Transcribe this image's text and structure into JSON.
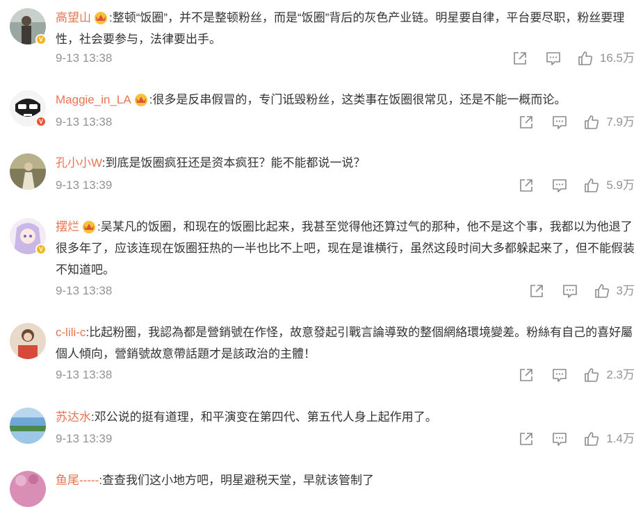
{
  "comments": [
    {
      "user": "高望山",
      "has_crown": true,
      "verified": "gold",
      "text": ":整顿“饭圈”，并不是整顿粉丝，而是“饭圈”背后的灰色产业链。明星要自律，平台要尽职，粉丝要理性，社会要参与，法律要出手。",
      "time": "9-13 13:38",
      "likes": "16.5万"
    },
    {
      "user": "Maggie_in_LA",
      "has_crown": true,
      "verified": "red",
      "text": ":很多是反串假冒的，专门诋毁粉丝，这类事在饭圈很常见，还是不能一概而论。",
      "time": "9-13 13:38",
      "likes": "7.9万"
    },
    {
      "user": "孔小小W",
      "has_crown": false,
      "verified": "",
      "text": ":到底是饭圈疯狂还是资本疯狂？能不能都说一说？",
      "time": "9-13 13:39",
      "likes": "5.9万"
    },
    {
      "user": "摆烂",
      "has_crown": true,
      "verified": "gold",
      "text": ":吴某凡的饭圈，和现在的饭圈比起来，我甚至觉得他还算过气的那种，他不是这个事，我都以为他退了很多年了，应该连现在饭圈狂热的一半也比不上吧，现在是谁横行，虽然这段时间大多都躲起来了，但不能假装不知道吧。",
      "time": "9-13 13:38",
      "likes": "3万"
    },
    {
      "user": "c-lili-c",
      "has_crown": false,
      "verified": "",
      "text": ":比起粉圈，我認為都是營銷號在作怪，故意發起引戰言論導致的整個網絡環境變差。粉絲有自己的喜好屬個人傾向，營銷號故意帶話題才是該政治的主體！",
      "time": "9-13 13:38",
      "likes": "2.3万"
    },
    {
      "user": "苏达水",
      "has_crown": false,
      "verified": "",
      "text": ":邓公说的挺有道理，和平演变在第四代、第五代人身上起作用了。",
      "time": "9-13 13:39",
      "likes": "1.4万"
    },
    {
      "user": "鱼尾-----",
      "has_crown": false,
      "verified": "",
      "text": ":查查我们这小地方吧，明星避税天堂，早就该管制了",
      "time": "",
      "likes": ""
    }
  ],
  "icons": {
    "share": "share-icon",
    "reply": "comment-icon",
    "like": "thumbs-up-icon",
    "crown": "crown-badge-icon",
    "verified": "verified-v-icon"
  },
  "colors": {
    "username": "#eb7350",
    "text": "#333333",
    "meta": "#939393",
    "crown": "#f2b41c"
  }
}
